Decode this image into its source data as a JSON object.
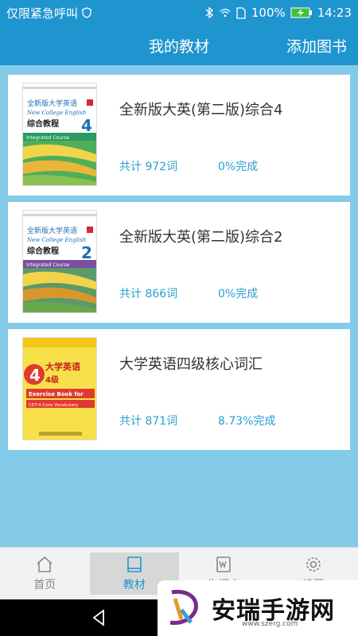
{
  "status": {
    "carrier": "仅限紧急呼叫",
    "battery": "100%",
    "time": "14:23"
  },
  "header": {
    "title": "我的教材",
    "action": "添加图书"
  },
  "books": [
    {
      "title": "全新版大英(第二版)综合4",
      "count": "共计 972词",
      "progress": "0%完成",
      "cover": {
        "line1": "全新版大学英语",
        "line2": "New College English",
        "line3": "综合教程",
        "line4": "Integrated Course",
        "number": "4"
      }
    },
    {
      "title": "全新版大英(第二版)综合2",
      "count": "共计 866词",
      "progress": "0%完成",
      "cover": {
        "line1": "全新版大学英语",
        "line2": "New College English",
        "line3": "综合教程",
        "line4": "Integrated Course",
        "number": "2"
      }
    },
    {
      "title": "大学英语四级核心词汇",
      "count": "共计 871词",
      "progress": "8.73%完成",
      "cover": {
        "line1": "大学英语",
        "line2": "4级",
        "line3": "Exercise Book for",
        "line4": "CET-4 Core Vocabulary"
      }
    }
  ],
  "nav": {
    "home": "首页",
    "textbook": "教材",
    "wordbook": "生词本",
    "settings": "设置"
  },
  "watermark": {
    "name": "安瑞手游网",
    "url": "www.szerg.com"
  }
}
